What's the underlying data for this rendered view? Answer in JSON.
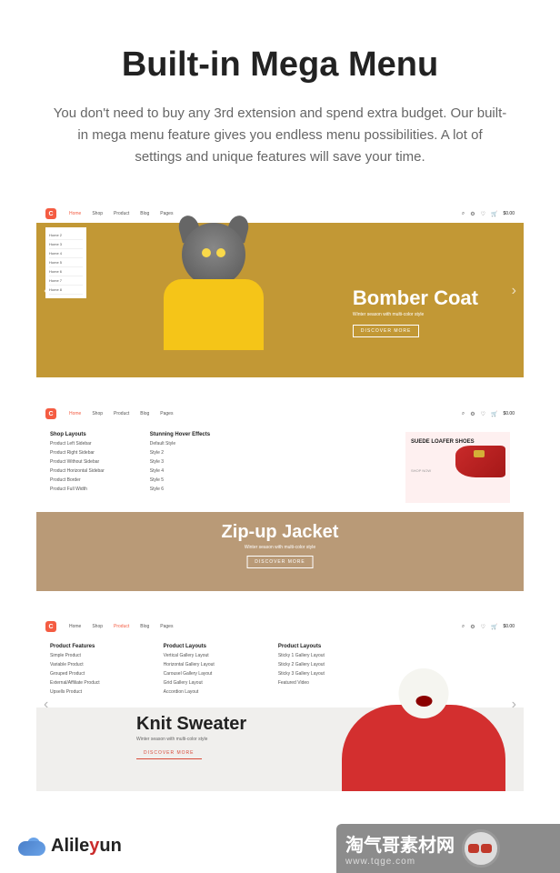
{
  "header": {
    "title": "Built-in Mega Menu",
    "subtitle": "You don't need to buy any 3rd extension and spend extra budget. Our built-in mega menu feature gives you endless menu possibilities. A lot of settings and unique features will save your time."
  },
  "nav": {
    "items": [
      "Home",
      "Shop",
      "Product",
      "Blog",
      "Pages"
    ],
    "price": "$0.00"
  },
  "demo1": {
    "dropdown": [
      "Home 2",
      "Home 3",
      "Home 4",
      "Home 5",
      "Home 6",
      "Home 7",
      "Home 8"
    ],
    "hero_title": "Bomber Coat",
    "hero_sub": "Winter season with multi-color style",
    "hero_btn": "DISCOVER MORE"
  },
  "demo2": {
    "col1_title": "Shop Layouts",
    "col1_items": [
      "Product Left Sidebar",
      "Product Right Sidebar",
      "Product Without Sidebar",
      "Product Horizontal Sidebar",
      "Product Border",
      "Product Full Width"
    ],
    "col2_title": "Stunning Hover Effects",
    "col2_items": [
      "Default Style",
      "Style 2",
      "Style 3",
      "Style 4",
      "Style 5",
      "Style 6"
    ],
    "promo_title": "SUEDE LOAFER SHOES",
    "promo_btn": "SHOP NOW",
    "hero_title": "Zip-up Jacket",
    "hero_sub": "Winter season with multi-color style",
    "hero_btn": "DISCOVER MORE"
  },
  "demo3": {
    "col1_title": "Product Features",
    "col1_items": [
      "Simple Product",
      "Variable Product",
      "Grouped Product",
      "External/Affiliate Product",
      "Upsells Product"
    ],
    "col2_title": "Product Layouts",
    "col2_items": [
      "Vertical Gallery Layout",
      "Horizontal Gallery Layout",
      "Carousel Gallery Layout",
      "Grid Gallery Layout",
      "Accordion Layout"
    ],
    "col3_title": "Product Layouts",
    "col3_items": [
      "Sticky 1 Gallery Layout",
      "Sticky 2 Gallery Layout",
      "Sticky 3 Gallery Layout",
      "Featured Video"
    ],
    "hero_title": "Knit Sweater",
    "hero_sub": "Winter season with multi-color style",
    "hero_btn": "DISCOVER MORE"
  },
  "watermark": {
    "text": "淘气哥素材网",
    "url": "www.tqge.com"
  },
  "alile": {
    "brand": "Alileyun"
  }
}
